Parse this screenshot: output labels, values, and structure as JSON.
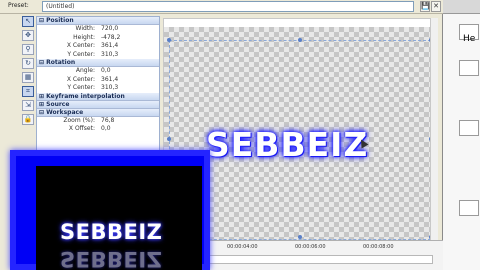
{
  "preset": {
    "label": "Preset:",
    "value": "(Untitled)"
  },
  "tools": [
    {
      "icon": "pointer-icon",
      "glyph": "↖"
    },
    {
      "icon": "move-icon",
      "glyph": "✥"
    },
    {
      "icon": "zoom-icon",
      "glyph": "⚲"
    },
    {
      "icon": "rotate-icon",
      "glyph": "↻"
    },
    {
      "icon": "grid-icon",
      "glyph": "▦"
    },
    {
      "icon": "snap-icon",
      "glyph": "⌗"
    },
    {
      "icon": "scale-icon",
      "glyph": "⇲"
    },
    {
      "icon": "lock-icon",
      "glyph": "🔒"
    }
  ],
  "props": {
    "position": {
      "title": "Position",
      "rows": [
        {
          "k": "Width:",
          "v": "720,0"
        },
        {
          "k": "Height:",
          "v": "-478,2"
        },
        {
          "k": "X Center:",
          "v": "361,4"
        },
        {
          "k": "Y Center:",
          "v": "310,3"
        }
      ]
    },
    "rotation": {
      "title": "Rotation",
      "rows": [
        {
          "k": "Angle:",
          "v": "0,0"
        },
        {
          "k": "X Center:",
          "v": "361,4"
        },
        {
          "k": "Y Center:",
          "v": "310,3"
        }
      ]
    },
    "keyframe": {
      "title": "Keyframe interpolation"
    },
    "source": {
      "title": "Source"
    },
    "workspace": {
      "title": "Workspace",
      "rows": [
        {
          "k": "Zoom (%):",
          "v": "76,8"
        },
        {
          "k": "X Offset:",
          "v": "0,0"
        }
      ]
    }
  },
  "canvas": {
    "text": "SEBBEIZ"
  },
  "timeline": {
    "marks": [
      "00:00:04:00",
      "00:00:06:00",
      "00:00:08:00"
    ]
  },
  "preview": {
    "text": "SEBBEIZ",
    "reflection": "SEBBEIZ"
  },
  "sidebar": {
    "letter": "He"
  }
}
